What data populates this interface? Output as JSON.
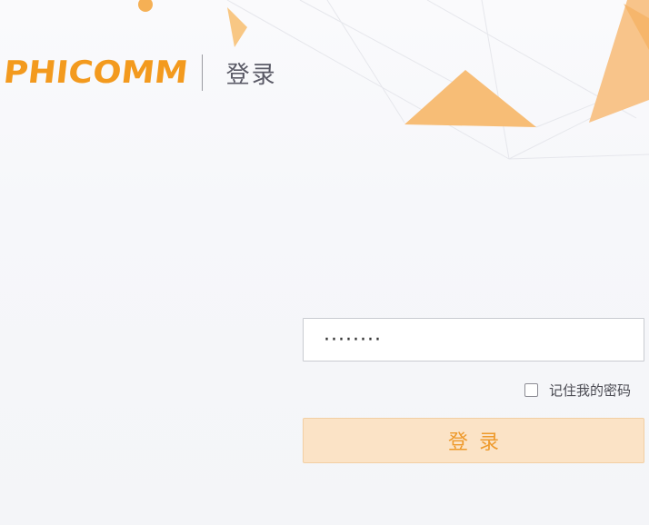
{
  "brand": {
    "logo_text": "PHICOMM",
    "accent_color": "#f39a1e"
  },
  "header": {
    "title": "登录"
  },
  "form": {
    "password_value": "········",
    "remember_label": "记住我的密码",
    "remember_checked": false,
    "submit_label": "登录"
  },
  "icons": {
    "logo_mark": "phicomm-swoosh-icon",
    "checkbox": "checkbox-icon"
  }
}
